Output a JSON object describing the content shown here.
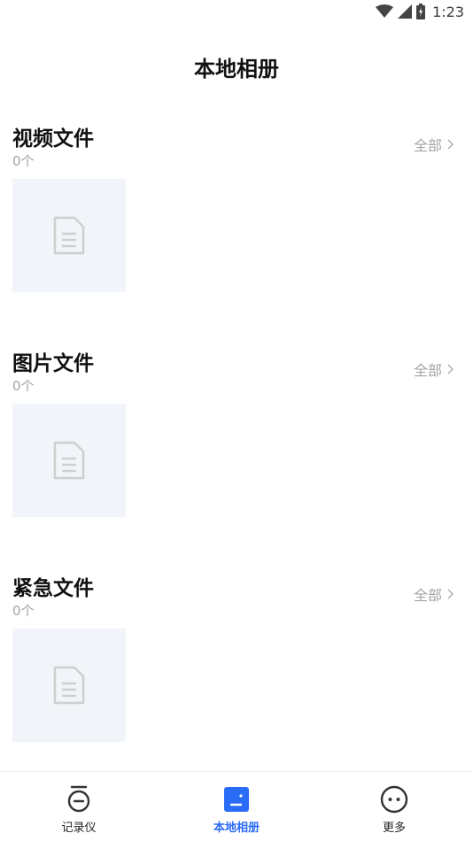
{
  "status_bar": {
    "time": "1:23"
  },
  "page_title": "本地相册",
  "sections": [
    {
      "title": "视频文件",
      "count": "0个",
      "all_label": "全部"
    },
    {
      "title": "图片文件",
      "count": "0个",
      "all_label": "全部"
    },
    {
      "title": "紧急文件",
      "count": "0个",
      "all_label": "全部"
    }
  ],
  "bottom_nav": [
    {
      "label": "记录仪",
      "icon": "dashcam-icon",
      "active": false
    },
    {
      "label": "本地相册",
      "icon": "album-icon",
      "active": true
    },
    {
      "label": "更多",
      "icon": "more-icon",
      "active": false
    }
  ],
  "colors": {
    "accent": "#2b6cf6",
    "muted_text": "#a4a4a4",
    "thumbnail_bg": "#f1f4f8",
    "placeholder_icon": "#cfcfcf"
  }
}
